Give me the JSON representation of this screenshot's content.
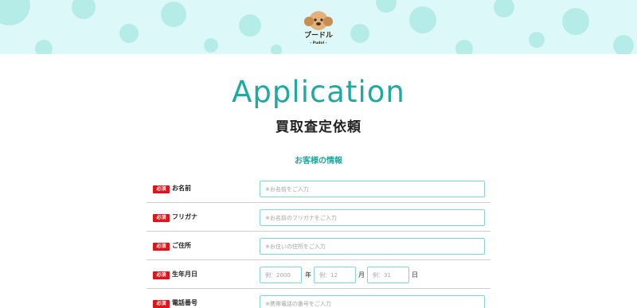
{
  "header": {
    "logo_text": "プードル",
    "logo_subtext": "- Pudol -"
  },
  "page": {
    "title": "Application",
    "subtitle": "買取査定依頼",
    "section_heading": "お客様の情報"
  },
  "form": {
    "required_badge": "必須",
    "name": {
      "label": "お名前",
      "placeholder": "※お名前をご入力"
    },
    "furigana": {
      "label": "フリガナ",
      "placeholder": "※お名前のフリガナをご入力"
    },
    "address": {
      "label": "ご住所",
      "placeholder": "※お住いの住所をご入力"
    },
    "birthdate": {
      "label": "生年月日",
      "year_placeholder": "例：2000",
      "year_unit": "年",
      "month_placeholder": "例：12",
      "month_unit": "月",
      "day_placeholder": "例：31",
      "day_unit": "日"
    },
    "phone": {
      "label": "電話番号",
      "placeholder": "※携帯電話の番号をご入力"
    }
  },
  "colors": {
    "accent": "#1fa9a0",
    "required": "#e5121b",
    "header_bg": "#dcf8f8",
    "input_border": "#86d4cf"
  }
}
